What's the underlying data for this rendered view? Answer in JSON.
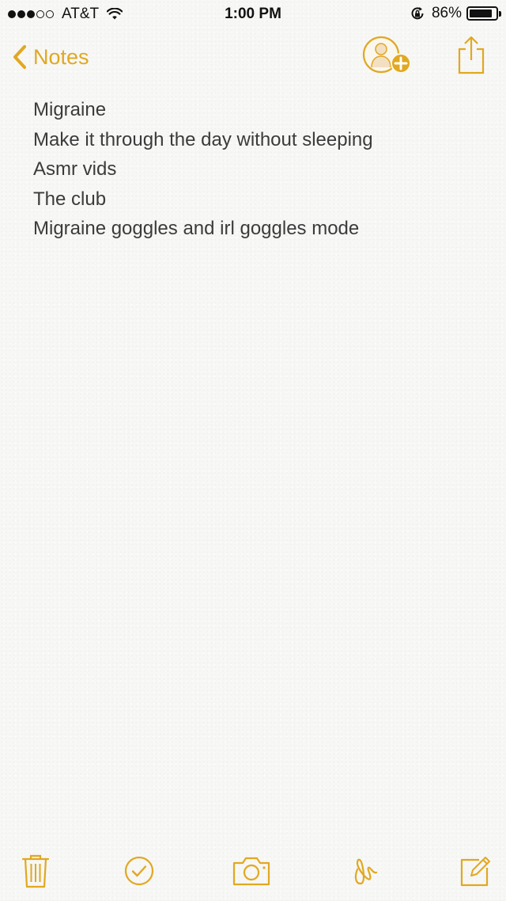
{
  "status_bar": {
    "carrier": "AT&T",
    "time": "1:00 PM",
    "battery_percent": "86%",
    "battery_level": 0.86,
    "signal_bars_filled": 3,
    "signal_bars_total": 5
  },
  "nav": {
    "back_label": "Notes"
  },
  "note": {
    "lines": [
      "Migraine",
      "Make it through the day without sleeping",
      "Asmr vids",
      "The club",
      "Migraine goggles and irl goggles mode"
    ]
  },
  "toolbar": {
    "icons": [
      "trash-icon",
      "checklist-icon",
      "camera-icon",
      "sketch-icon",
      "compose-icon"
    ]
  },
  "colors": {
    "accent": "#e1a821",
    "text": "#3b3b3b",
    "paper": "#f7f7f5"
  }
}
